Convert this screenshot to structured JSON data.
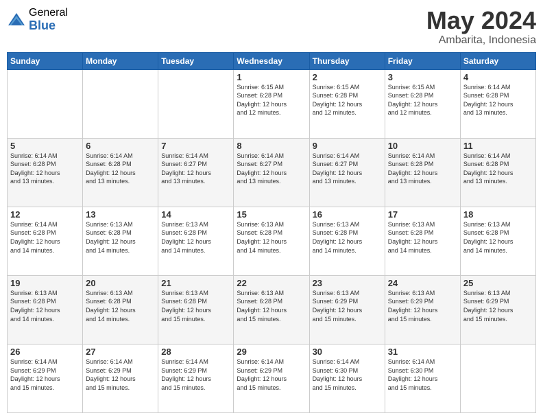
{
  "logo": {
    "general": "General",
    "blue": "Blue"
  },
  "header": {
    "title": "May 2024",
    "subtitle": "Ambarita, Indonesia"
  },
  "weekdays": [
    "Sunday",
    "Monday",
    "Tuesday",
    "Wednesday",
    "Thursday",
    "Friday",
    "Saturday"
  ],
  "weeks": [
    [
      {
        "day": "",
        "info": ""
      },
      {
        "day": "",
        "info": ""
      },
      {
        "day": "",
        "info": ""
      },
      {
        "day": "1",
        "info": "Sunrise: 6:15 AM\nSunset: 6:28 PM\nDaylight: 12 hours\nand 12 minutes."
      },
      {
        "day": "2",
        "info": "Sunrise: 6:15 AM\nSunset: 6:28 PM\nDaylight: 12 hours\nand 12 minutes."
      },
      {
        "day": "3",
        "info": "Sunrise: 6:15 AM\nSunset: 6:28 PM\nDaylight: 12 hours\nand 12 minutes."
      },
      {
        "day": "4",
        "info": "Sunrise: 6:14 AM\nSunset: 6:28 PM\nDaylight: 12 hours\nand 13 minutes."
      }
    ],
    [
      {
        "day": "5",
        "info": "Sunrise: 6:14 AM\nSunset: 6:28 PM\nDaylight: 12 hours\nand 13 minutes."
      },
      {
        "day": "6",
        "info": "Sunrise: 6:14 AM\nSunset: 6:28 PM\nDaylight: 12 hours\nand 13 minutes."
      },
      {
        "day": "7",
        "info": "Sunrise: 6:14 AM\nSunset: 6:27 PM\nDaylight: 12 hours\nand 13 minutes."
      },
      {
        "day": "8",
        "info": "Sunrise: 6:14 AM\nSunset: 6:27 PM\nDaylight: 12 hours\nand 13 minutes."
      },
      {
        "day": "9",
        "info": "Sunrise: 6:14 AM\nSunset: 6:27 PM\nDaylight: 12 hours\nand 13 minutes."
      },
      {
        "day": "10",
        "info": "Sunrise: 6:14 AM\nSunset: 6:28 PM\nDaylight: 12 hours\nand 13 minutes."
      },
      {
        "day": "11",
        "info": "Sunrise: 6:14 AM\nSunset: 6:28 PM\nDaylight: 12 hours\nand 13 minutes."
      }
    ],
    [
      {
        "day": "12",
        "info": "Sunrise: 6:14 AM\nSunset: 6:28 PM\nDaylight: 12 hours\nand 14 minutes."
      },
      {
        "day": "13",
        "info": "Sunrise: 6:13 AM\nSunset: 6:28 PM\nDaylight: 12 hours\nand 14 minutes."
      },
      {
        "day": "14",
        "info": "Sunrise: 6:13 AM\nSunset: 6:28 PM\nDaylight: 12 hours\nand 14 minutes."
      },
      {
        "day": "15",
        "info": "Sunrise: 6:13 AM\nSunset: 6:28 PM\nDaylight: 12 hours\nand 14 minutes."
      },
      {
        "day": "16",
        "info": "Sunrise: 6:13 AM\nSunset: 6:28 PM\nDaylight: 12 hours\nand 14 minutes."
      },
      {
        "day": "17",
        "info": "Sunrise: 6:13 AM\nSunset: 6:28 PM\nDaylight: 12 hours\nand 14 minutes."
      },
      {
        "day": "18",
        "info": "Sunrise: 6:13 AM\nSunset: 6:28 PM\nDaylight: 12 hours\nand 14 minutes."
      }
    ],
    [
      {
        "day": "19",
        "info": "Sunrise: 6:13 AM\nSunset: 6:28 PM\nDaylight: 12 hours\nand 14 minutes."
      },
      {
        "day": "20",
        "info": "Sunrise: 6:13 AM\nSunset: 6:28 PM\nDaylight: 12 hours\nand 14 minutes."
      },
      {
        "day": "21",
        "info": "Sunrise: 6:13 AM\nSunset: 6:28 PM\nDaylight: 12 hours\nand 15 minutes."
      },
      {
        "day": "22",
        "info": "Sunrise: 6:13 AM\nSunset: 6:28 PM\nDaylight: 12 hours\nand 15 minutes."
      },
      {
        "day": "23",
        "info": "Sunrise: 6:13 AM\nSunset: 6:29 PM\nDaylight: 12 hours\nand 15 minutes."
      },
      {
        "day": "24",
        "info": "Sunrise: 6:13 AM\nSunset: 6:29 PM\nDaylight: 12 hours\nand 15 minutes."
      },
      {
        "day": "25",
        "info": "Sunrise: 6:13 AM\nSunset: 6:29 PM\nDaylight: 12 hours\nand 15 minutes."
      }
    ],
    [
      {
        "day": "26",
        "info": "Sunrise: 6:14 AM\nSunset: 6:29 PM\nDaylight: 12 hours\nand 15 minutes."
      },
      {
        "day": "27",
        "info": "Sunrise: 6:14 AM\nSunset: 6:29 PM\nDaylight: 12 hours\nand 15 minutes."
      },
      {
        "day": "28",
        "info": "Sunrise: 6:14 AM\nSunset: 6:29 PM\nDaylight: 12 hours\nand 15 minutes."
      },
      {
        "day": "29",
        "info": "Sunrise: 6:14 AM\nSunset: 6:29 PM\nDaylight: 12 hours\nand 15 minutes."
      },
      {
        "day": "30",
        "info": "Sunrise: 6:14 AM\nSunset: 6:30 PM\nDaylight: 12 hours\nand 15 minutes."
      },
      {
        "day": "31",
        "info": "Sunrise: 6:14 AM\nSunset: 6:30 PM\nDaylight: 12 hours\nand 15 minutes."
      },
      {
        "day": "",
        "info": ""
      }
    ]
  ]
}
